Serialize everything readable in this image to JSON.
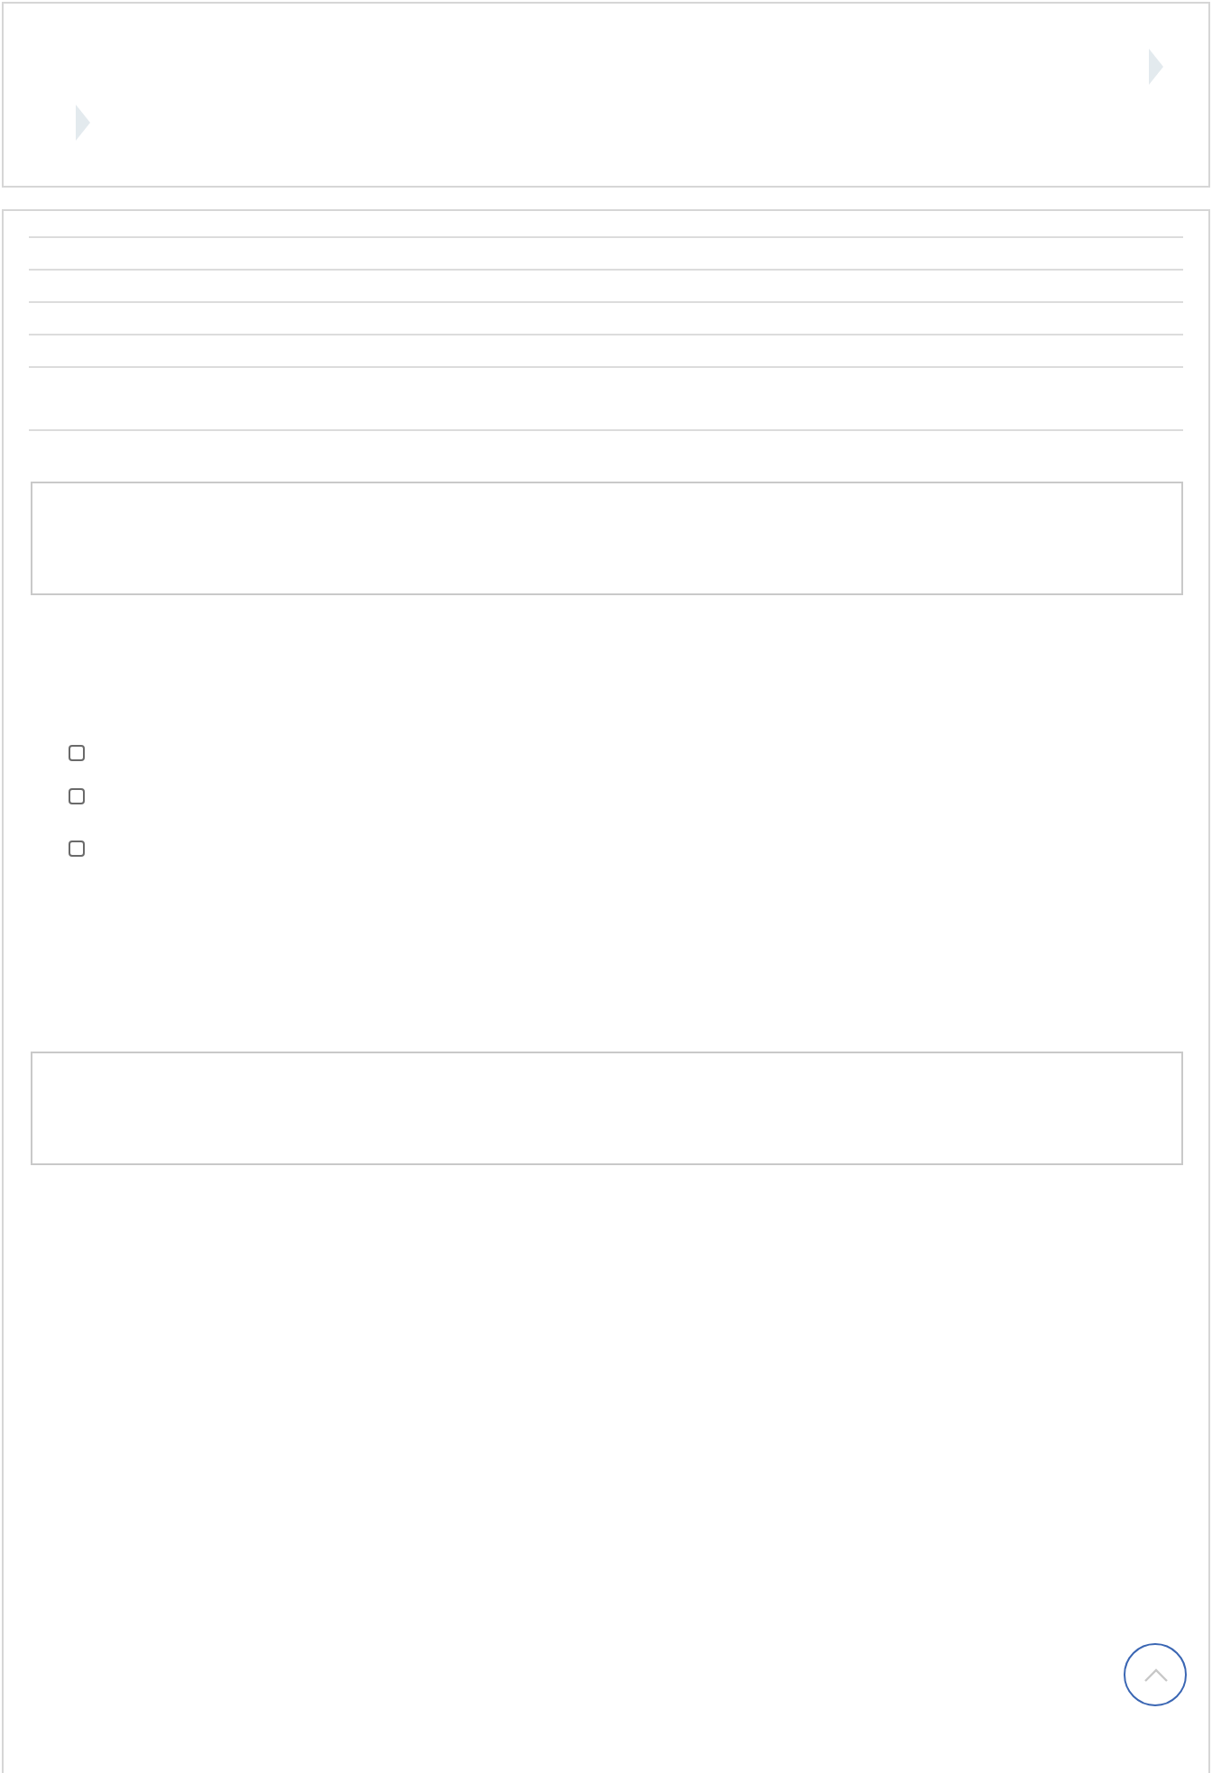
{
  "checklist": [
    {
      "checked": false
    },
    {
      "checked": false
    },
    {
      "checked": false
    }
  ]
}
